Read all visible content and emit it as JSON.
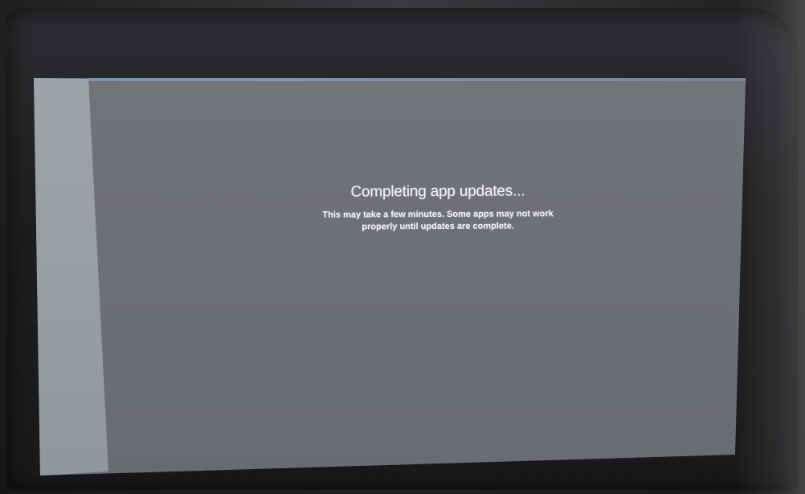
{
  "update_screen": {
    "title": "Completing app updates...",
    "body_line_1": "This may take a few minutes. Some apps may not work",
    "body_line_2": "properly until updates are complete."
  },
  "colors": {
    "display_background": "#6e7176",
    "display_left_strip": "#9aa1a6",
    "progress_line": "#8a9dba",
    "text": "#f4f4f4",
    "bezel": "#1e1f21"
  }
}
